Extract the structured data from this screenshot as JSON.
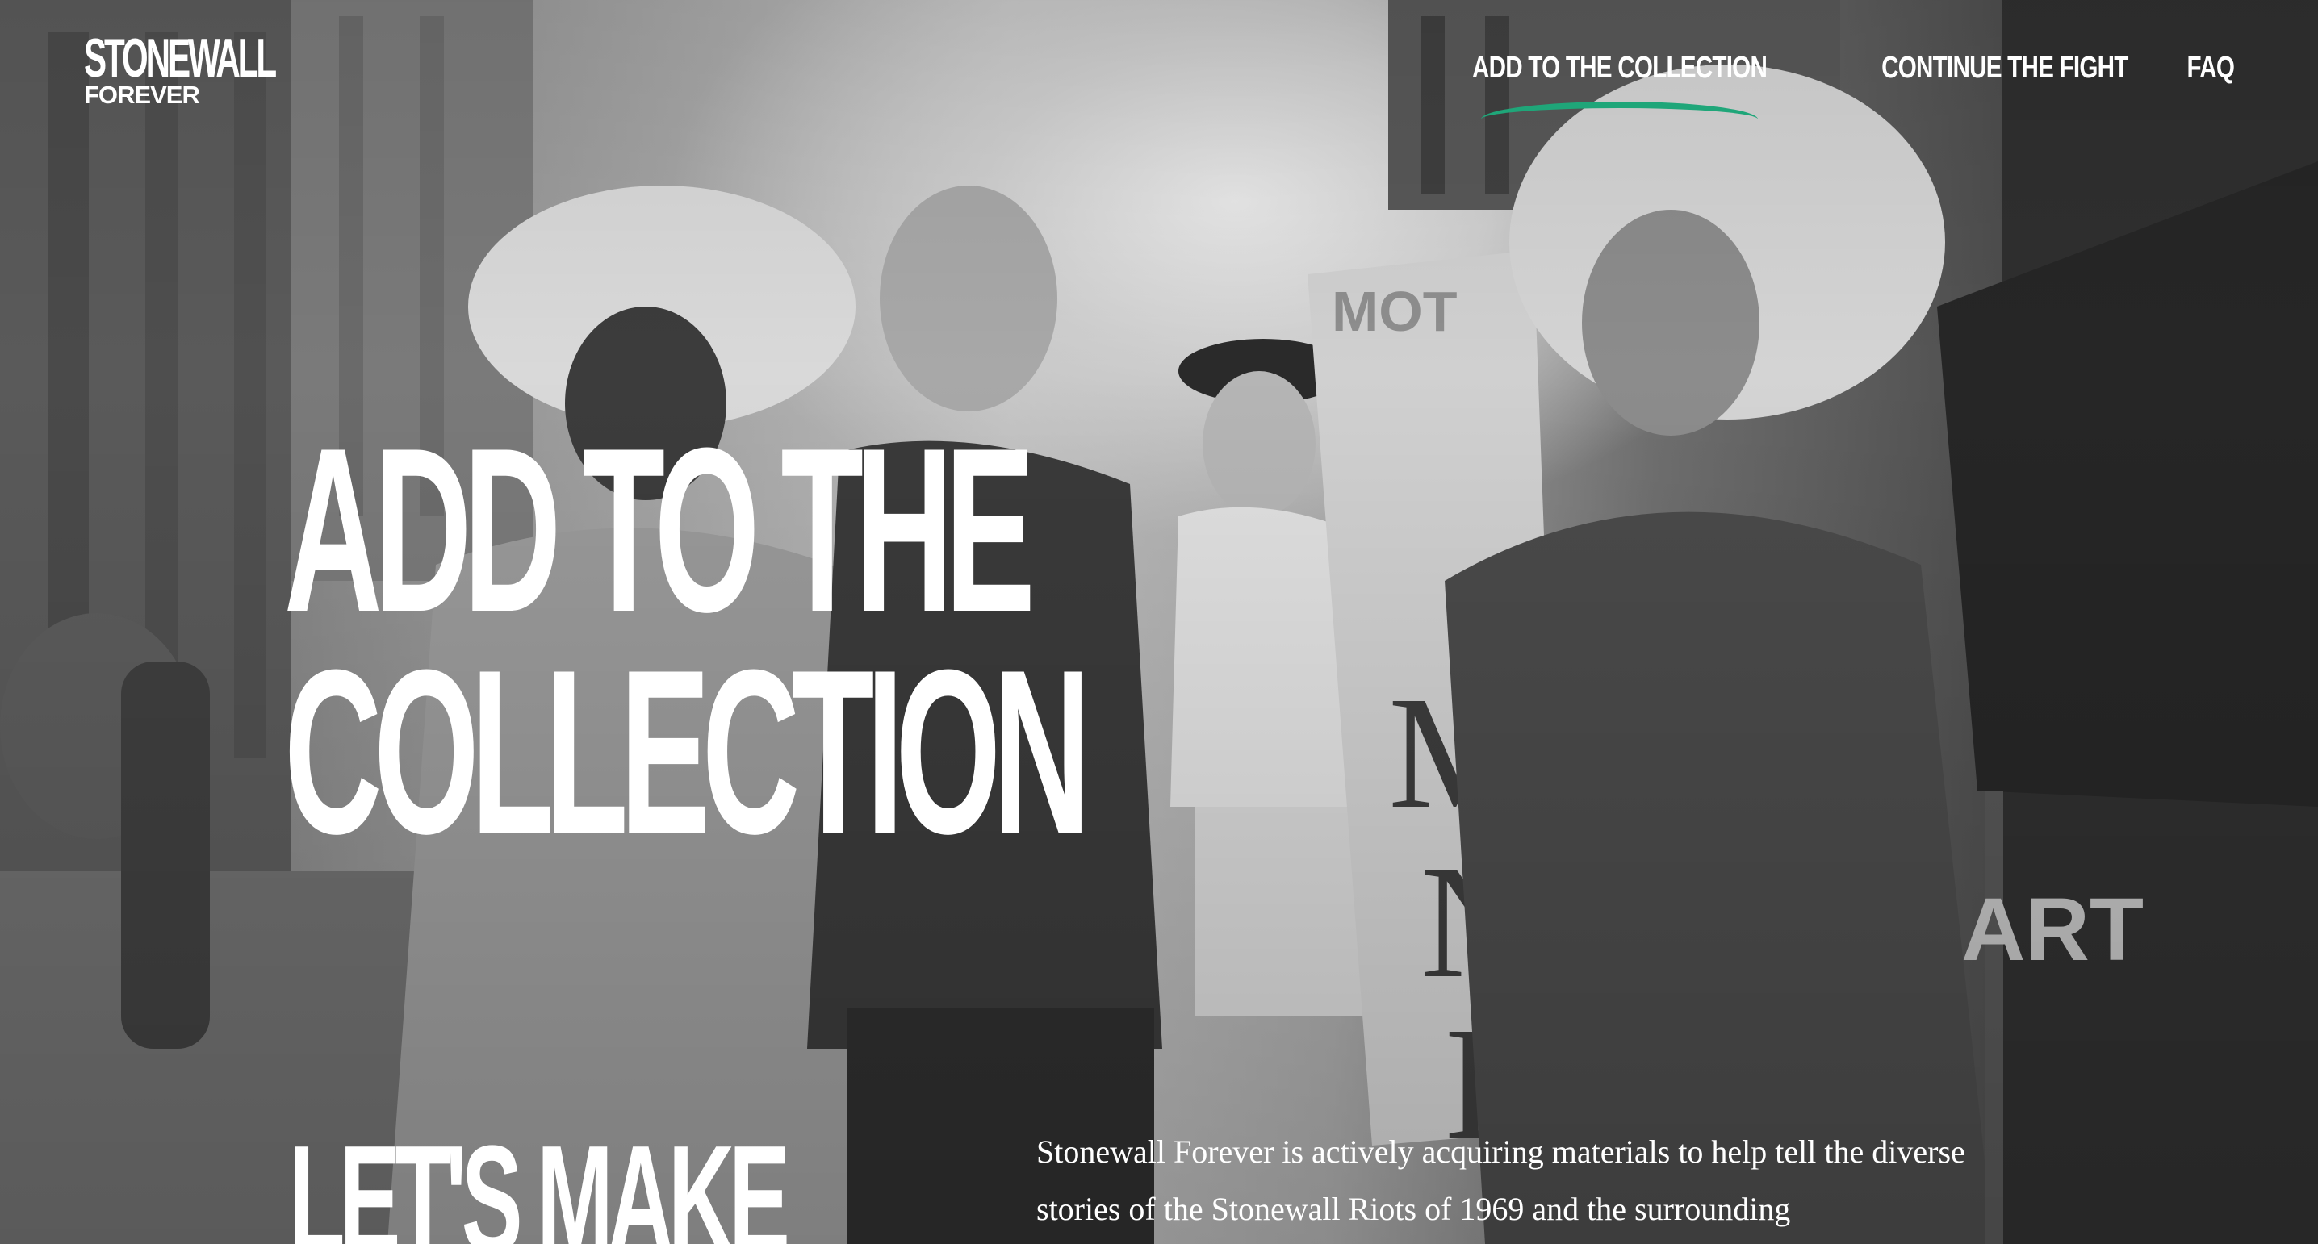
{
  "header": {
    "logo": {
      "line1": "STONEWALL",
      "line2": "FOREVER"
    },
    "nav": [
      {
        "label": "ADD TO THE COLLECTION",
        "active": true
      },
      {
        "label": "CONTINUE THE FIGHT",
        "active": false
      },
      {
        "label": "FAQ",
        "active": false
      }
    ]
  },
  "hero": {
    "title_line1": "ADD TO THE",
    "title_line2": "COLLECTION",
    "background": "black-and-white photograph of marchers at a street protest"
  },
  "section": {
    "heading": "LET'S MAKE",
    "text": "Stonewall Forever is actively acquiring materials to help tell the diverse stories of the Stonewall Riots of 1969 and the surrounding"
  },
  "colors": {
    "accent": "#1fa679",
    "text": "#ffffff"
  }
}
